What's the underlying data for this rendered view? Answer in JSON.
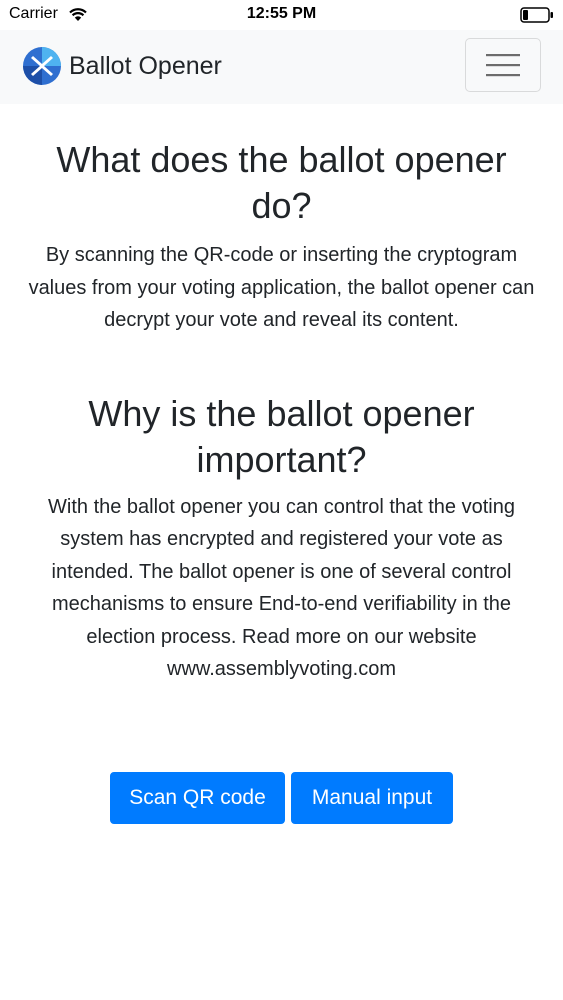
{
  "status_bar": {
    "carrier": "Carrier",
    "time": "12:55 PM",
    "icons": [
      "wifi-icon",
      "battery-icon"
    ]
  },
  "navbar": {
    "brand": "Ballot Opener",
    "logo_icon": "assembly-voting-logo-icon",
    "menu_icon": "hamburger-menu-icon"
  },
  "sections": [
    {
      "title": "What does the ballot opener do?",
      "body": "By scanning the QR-code or inserting the cryptogram values from your voting application, the ballot opener can decrypt your vote and reveal its content."
    },
    {
      "title": "Why is the ballot opener important?",
      "body": "With the ballot opener you can control that the voting system has encrypted and registered your vote as intended. The ballot opener is one of several control mechanisms to ensure End-to-end verifiability in the election process. Read more on our website www.assemblyvoting.com"
    }
  ],
  "buttons": {
    "scan": "Scan QR code",
    "manual": "Manual input"
  },
  "colors": {
    "primary": "#007bff",
    "navbar_bg": "#f8f9fa",
    "text": "#212529",
    "logo_blue": "#2f6fd0",
    "logo_light": "#4fb3f0"
  }
}
